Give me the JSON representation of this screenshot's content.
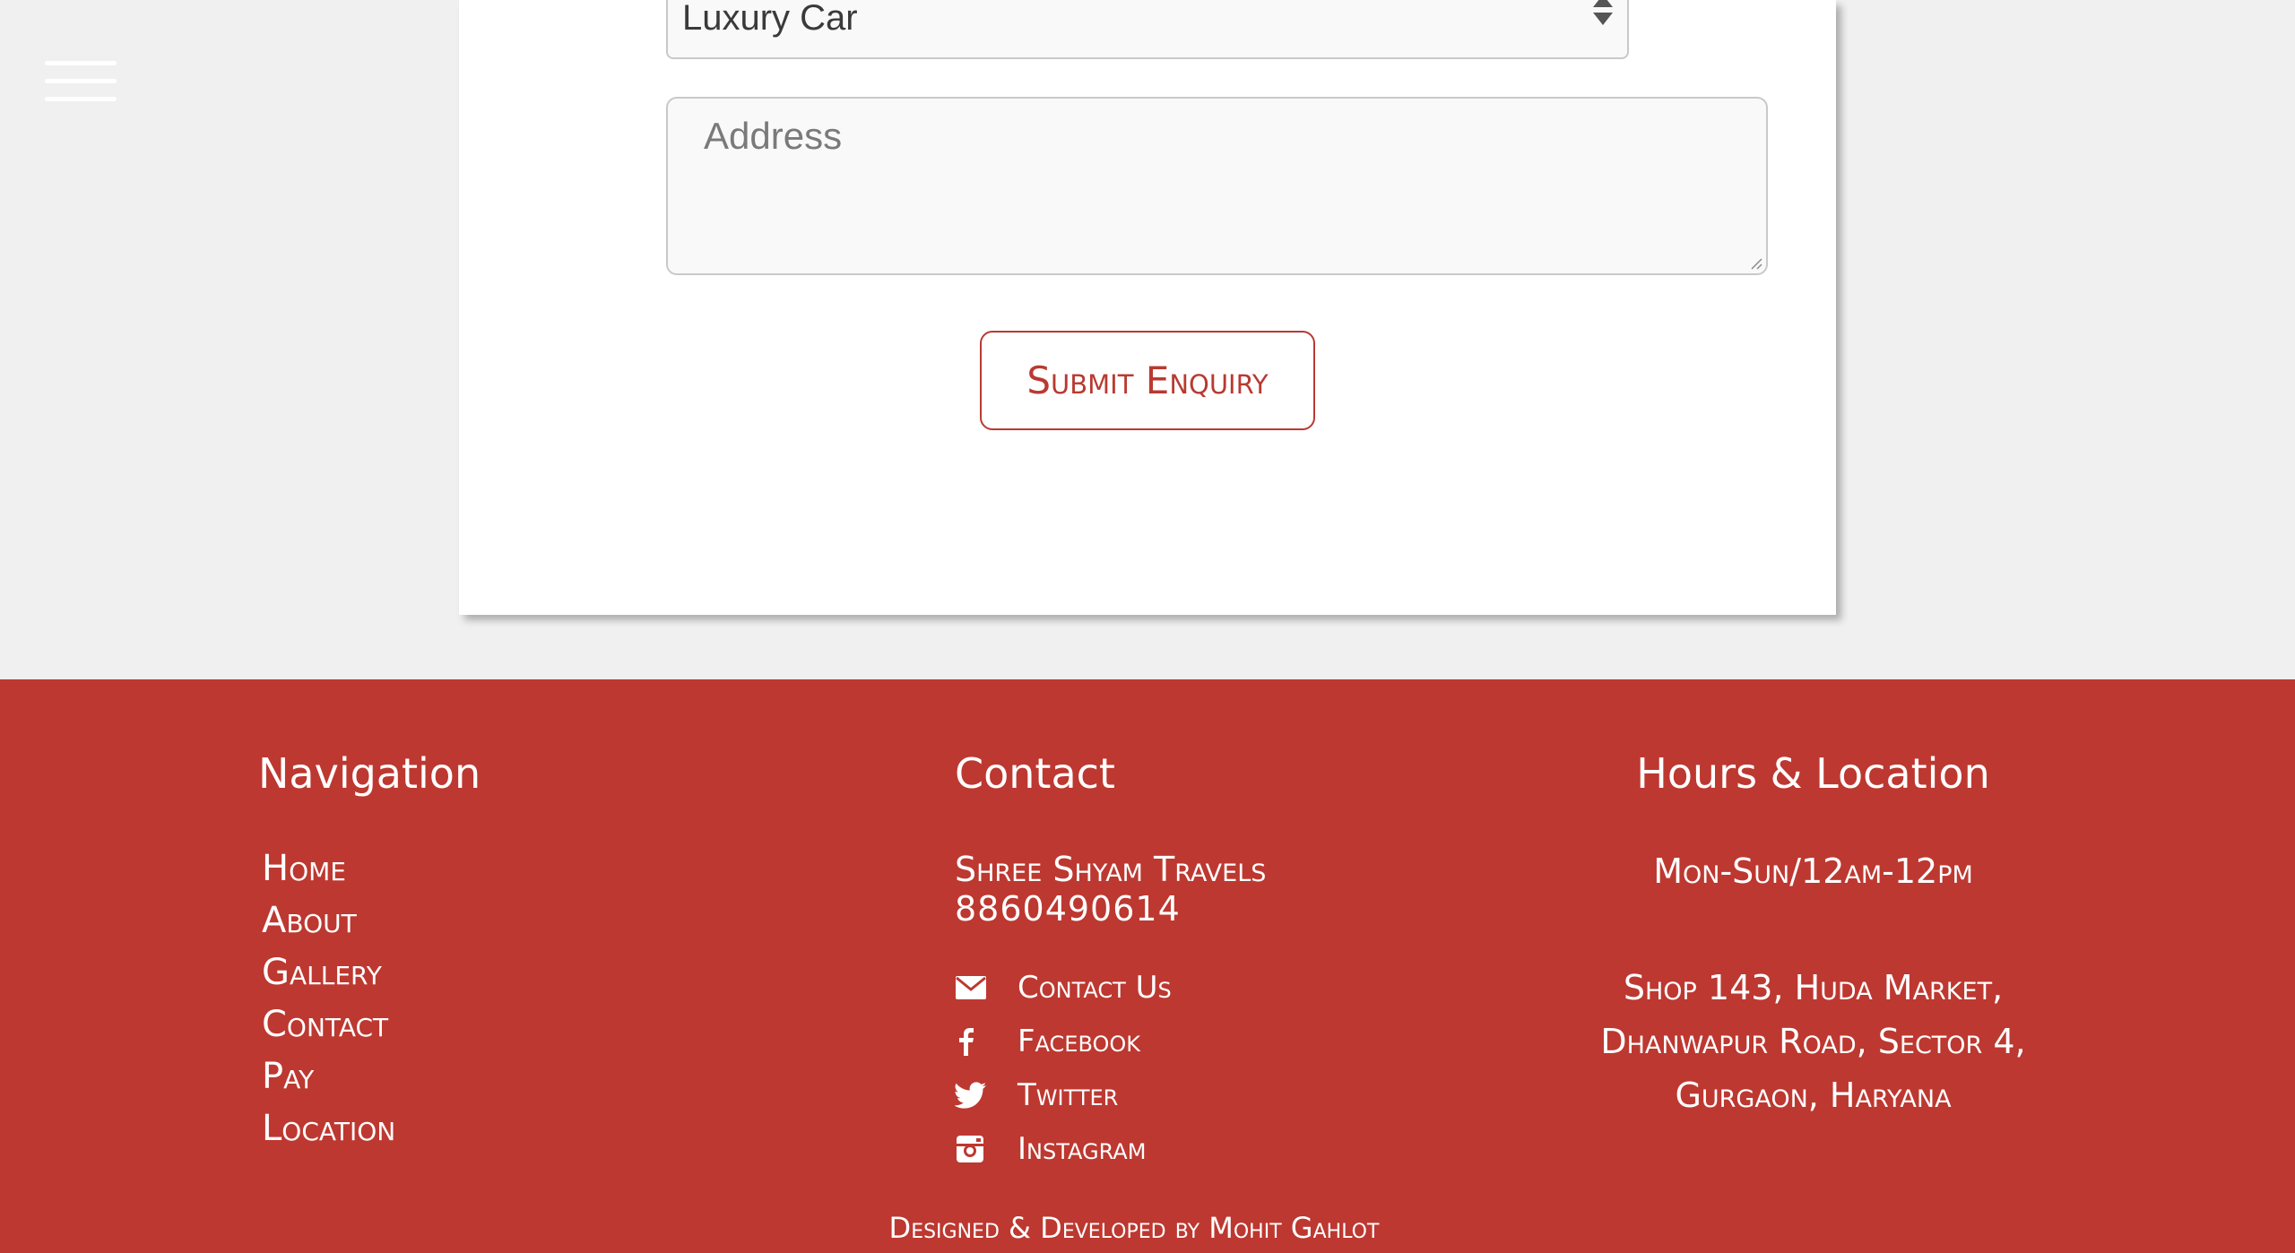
{
  "form": {
    "vehicle_select": {
      "selected": "Luxury Car"
    },
    "address": {
      "placeholder": "Address",
      "value": ""
    },
    "submit_label": "Submit Enquiry"
  },
  "footer": {
    "navigation": {
      "heading": "Navigation",
      "items": [
        {
          "label": "Home"
        },
        {
          "label": "About"
        },
        {
          "label": "Gallery"
        },
        {
          "label": "Contact"
        },
        {
          "label": "Pay"
        },
        {
          "label": "Location"
        }
      ]
    },
    "contact": {
      "heading": "Contact",
      "company": "Shree Shyam Travels",
      "phone": "8860490614",
      "links": [
        {
          "label": "Contact Us",
          "icon": "mail-icon"
        },
        {
          "label": "Facebook",
          "icon": "facebook-icon"
        },
        {
          "label": "Twitter",
          "icon": "twitter-icon"
        },
        {
          "label": "Instagram",
          "icon": "instagram-icon"
        }
      ]
    },
    "hours": {
      "heading": "Hours & Location",
      "hours": "Mon-Sun/12am-12pm",
      "address_lines": [
        "Shop 143, Huda Market,",
        "Dhanwapur Road, Sector 4,",
        "Gurgaon, Haryana"
      ]
    },
    "credits": "Designed & Developed by Mohit Gahlot"
  },
  "colors": {
    "brand_red": "#bd3830",
    "button_red": "#b83a32",
    "page_background": "#f0f0f0"
  }
}
